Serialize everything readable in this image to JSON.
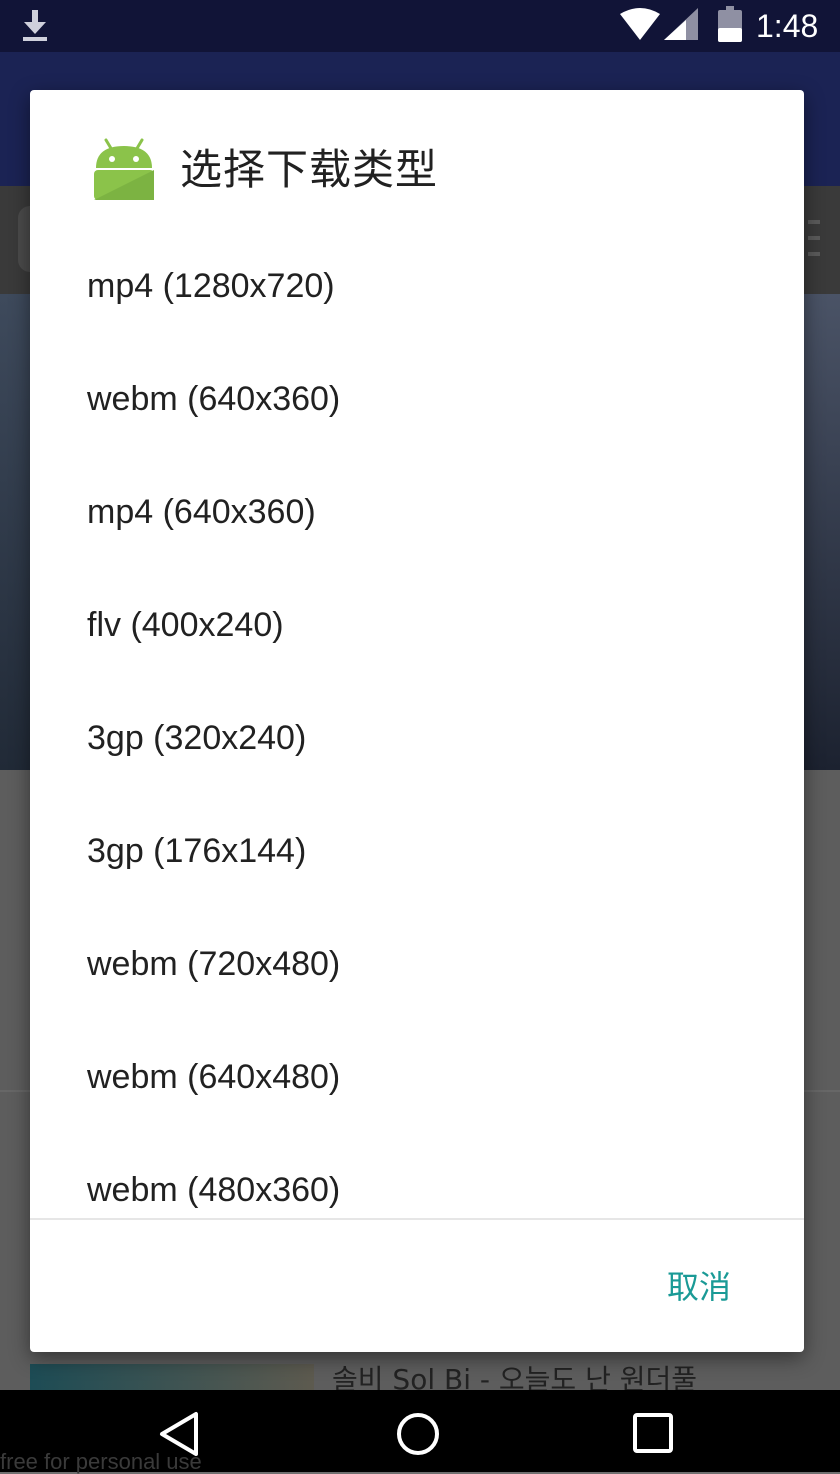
{
  "status_bar": {
    "time": "1:48",
    "icons": [
      "download-icon",
      "wifi-icon",
      "signal-icon",
      "battery-icon"
    ]
  },
  "dialog": {
    "title": "选择下载类型",
    "icon": "android-icon",
    "options": [
      "mp4 (1280x720)",
      "webm (640x360)",
      "mp4 (640x360)",
      "flv (400x240)",
      "3gp (320x240)",
      "3gp (176x144)",
      "webm (720x480)",
      "webm (640x480)",
      "webm (480x360)"
    ],
    "cancel_label": "取消",
    "accent_color": "#1a9a96"
  },
  "background": {
    "video_title": "솔비 Sol Bi - 오늘도 난 원더풀"
  },
  "nav_bar": {
    "icons": [
      "back-icon",
      "home-icon",
      "recents-icon"
    ]
  },
  "watermark": "free for personal use"
}
